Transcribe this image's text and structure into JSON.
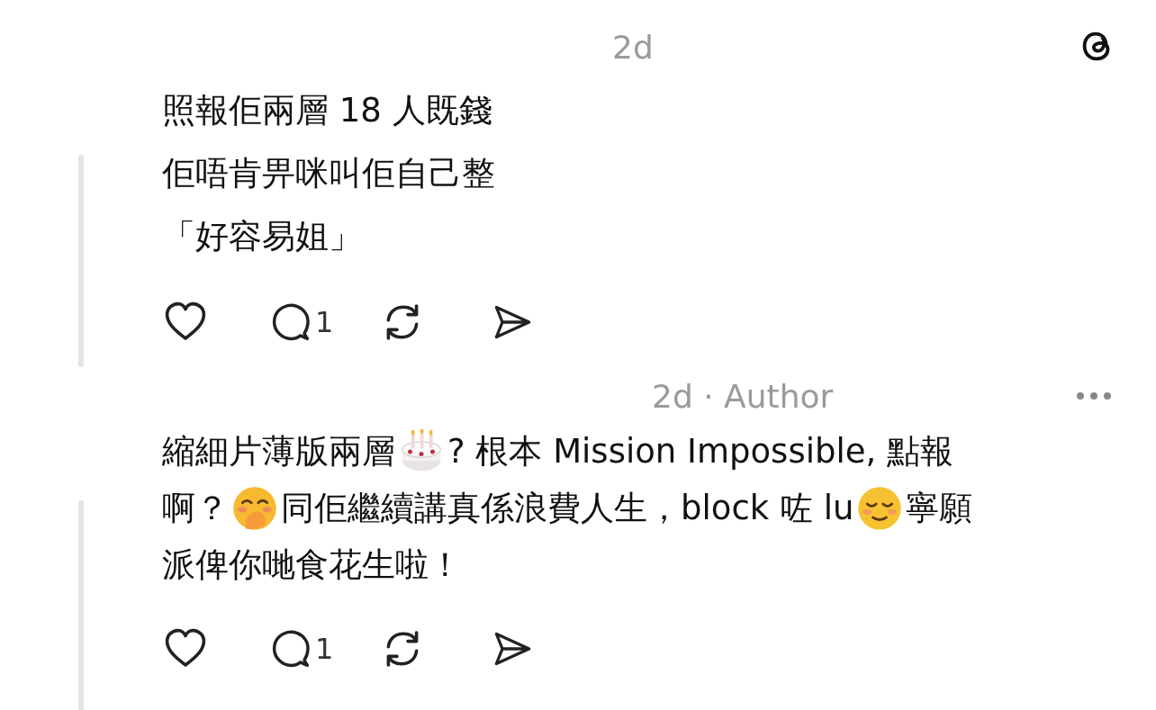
{
  "app": {
    "kind": "threads"
  },
  "comments": [
    {
      "time": "2d",
      "show_more": false,
      "lines": [
        [
          {
            "kind": "text",
            "text": "照報佢兩層 18 人既錢"
          }
        ],
        [
          {
            "kind": "text",
            "text": "佢唔肯畀咪叫佢自己整"
          }
        ],
        [
          {
            "kind": "text",
            "text": "「好容易姐」"
          }
        ]
      ],
      "replies": "1"
    },
    {
      "time": "2d · Author",
      "show_more": true,
      "lines": [
        [
          {
            "kind": "text",
            "text": "縮細片薄版兩層"
          },
          {
            "kind": "cake_emoji"
          },
          {
            "kind": "text",
            "text": "? 根本 Mission Impossible, 點報"
          }
        ],
        [
          {
            "kind": "text",
            "text": "啊？ "
          },
          {
            "kind": "giggle_emoji"
          },
          {
            "kind": "text",
            "text": "同佢繼續講真係浪費人生，block 咗 lu"
          },
          {
            "kind": "relieved_emoji"
          },
          {
            "kind": "text",
            "text": "寧願"
          }
        ],
        [
          {
            "kind": "text",
            "text": "派俾你哋食花生啦！"
          }
        ]
      ],
      "replies": "1"
    }
  ]
}
